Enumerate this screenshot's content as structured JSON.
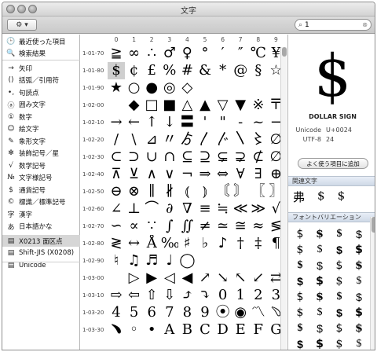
{
  "window": {
    "title": "文字"
  },
  "toolbar": {
    "action_label": "⚙ ▾",
    "search_value": "1"
  },
  "sidebar": {
    "items": [
      {
        "icon": "🕒",
        "icon_name": "clock-icon",
        "label": "最近使った項目"
      },
      {
        "icon": "🔍",
        "icon_name": "search-icon",
        "label": "検索結果"
      },
      {
        "icon": "→",
        "icon_name": "arrow-icon",
        "label": "矢印"
      },
      {
        "icon": "()",
        "icon_name": "bracket-icon",
        "label": "括弧／引用符"
      },
      {
        "icon": "•,",
        "icon_name": "punctuation-icon",
        "label": "句読点"
      },
      {
        "icon": "ⓐ",
        "icon_name": "circled-letter-icon",
        "label": "囲み文字"
      },
      {
        "icon": "①",
        "icon_name": "circled-number-icon",
        "label": "数字"
      },
      {
        "icon": "☺",
        "icon_name": "smiley-icon",
        "label": "絵文字"
      },
      {
        "icon": "✎",
        "icon_name": "pictograph-icon",
        "label": "象形文字"
      },
      {
        "icon": "✻",
        "icon_name": "star-icon",
        "label": "装飾記号／星"
      },
      {
        "icon": "√",
        "icon_name": "math-icon",
        "label": "数学記号"
      },
      {
        "icon": "№",
        "icon_name": "letterlike-icon",
        "label": "文字様記号"
      },
      {
        "icon": "$",
        "icon_name": "currency-icon",
        "label": "通貨記号"
      },
      {
        "icon": "©",
        "icon_name": "copyright-icon",
        "label": "標識／標準記号"
      },
      {
        "icon": "字",
        "icon_name": "kanji-icon",
        "label": "漢字"
      },
      {
        "icon": "あ",
        "icon_name": "hiragana-icon",
        "label": "日本語かな"
      },
      {
        "icon": "▤",
        "icon_name": "code-table-icon",
        "label": "X0213 面区点"
      },
      {
        "icon": "▤",
        "icon_name": "code-table-icon",
        "label": "Shift-JIS (X0208)"
      },
      {
        "icon": "▤",
        "icon_name": "code-table-icon",
        "label": "Unicode"
      }
    ]
  },
  "grid": {
    "columns": [
      "0",
      "1",
      "2",
      "3",
      "4",
      "5",
      "6",
      "7",
      "8",
      "9"
    ],
    "rows": [
      {
        "label": "1-01-70",
        "chars": [
          "≧",
          "∞",
          "∴",
          "♂",
          "♀",
          "°",
          "′",
          "″",
          "℃",
          "¥"
        ]
      },
      {
        "label": "1-01-80",
        "chars": [
          "$",
          "¢",
          "£",
          "%",
          "#",
          "&",
          "*",
          "@",
          "§",
          "☆"
        ]
      },
      {
        "label": "1-01-90",
        "chars": [
          "★",
          "○",
          "●",
          "◎",
          "◇",
          "",
          "",
          "",
          "",
          ""
        ]
      },
      {
        "label": "1-02-00",
        "chars": [
          "",
          "◆",
          "□",
          "■",
          "△",
          "▲",
          "▽",
          "▼",
          "※",
          "〒"
        ]
      },
      {
        "label": "1-02-10",
        "chars": [
          "→",
          "←",
          "↑",
          "↓",
          "〓",
          "'",
          "\"",
          "-",
          "~",
          "−"
        ]
      },
      {
        "label": "1-02-20",
        "chars": [
          "/",
          "\\",
          "⊿",
          "〃",
          "ゟ",
          "〳",
          "〴",
          "〵",
          "〻",
          "∅"
        ]
      },
      {
        "label": "1-02-30",
        "chars": [
          "⊂",
          "⊃",
          "∪",
          "∩",
          "⊆",
          "⊇",
          "⊊",
          "⊋",
          "⊄",
          "∅"
        ]
      },
      {
        "label": "1-02-40",
        "chars": [
          "⊼",
          "⊻",
          "∧",
          "∨",
          "¬",
          "⇒",
          "⇔",
          "∀",
          "∃",
          "⊕"
        ]
      },
      {
        "label": "1-02-50",
        "chars": [
          "⊖",
          "⊗",
          "∥",
          "∦",
          "⦅",
          "⦆",
          "〘",
          "〙",
          "〖",
          "〗"
        ]
      },
      {
        "label": "1-02-60",
        "chars": [
          "∠",
          "⊥",
          "⌒",
          "∂",
          "∇",
          "≡",
          "≒",
          "≪",
          "≫",
          "√"
        ]
      },
      {
        "label": "1-02-70",
        "chars": [
          "∽",
          "∝",
          "∵",
          "∫",
          "∬",
          "≠",
          "≃",
          "≅",
          "≈",
          "≶"
        ]
      },
      {
        "label": "1-02-80",
        "chars": [
          "≷",
          "↔",
          "Å",
          "‰",
          "♯",
          "♭",
          "♪",
          "†",
          "‡",
          "¶"
        ]
      },
      {
        "label": "1-02-90",
        "chars": [
          "♮",
          "♫",
          "♬",
          "♩",
          "◯",
          "",
          "",
          "",
          "",
          ""
        ]
      },
      {
        "label": "1-03-00",
        "chars": [
          "",
          "▷",
          "▶",
          "◁",
          "◀",
          "↗",
          "↘",
          "↖",
          "↙",
          "⇄"
        ]
      },
      {
        "label": "1-03-10",
        "chars": [
          "⇨",
          "⇦",
          "⇧",
          "⇩",
          "⤴",
          "⤵",
          "0",
          "1",
          "2",
          "3"
        ]
      },
      {
        "label": "1-03-20",
        "chars": [
          "4",
          "5",
          "6",
          "7",
          "8",
          "9",
          "⦿",
          "◉",
          "〽",
          "﹆"
        ]
      },
      {
        "label": "1-03-30",
        "chars": [
          "﹅",
          "◦",
          "•",
          "A",
          "B",
          "C",
          "D",
          "E",
          "F",
          "G"
        ]
      }
    ]
  },
  "selected": {
    "glyph": "$",
    "name": "DOLLAR SIGN",
    "unicode_label": "Unicode",
    "unicode_value": "U+0024",
    "utf8_label": "UTF-8",
    "utf8_value": "24",
    "add_favorite_label": "よく使う項目に追加"
  },
  "related": {
    "title": "関連文字",
    "chars": [
      "弗",
      "$",
      "$"
    ]
  },
  "variants": {
    "title": "フォントバリエーション",
    "chars": [
      "$",
      "$",
      "$",
      "$",
      "$",
      "$",
      "$",
      "$",
      "$",
      "$",
      "$",
      "$",
      "$",
      "$",
      "$",
      "$",
      "$",
      "$",
      "$",
      "$",
      "$",
      "$",
      "$",
      "$",
      "$",
      "$",
      "$",
      "$",
      "$",
      "$",
      "$",
      "$"
    ]
  }
}
